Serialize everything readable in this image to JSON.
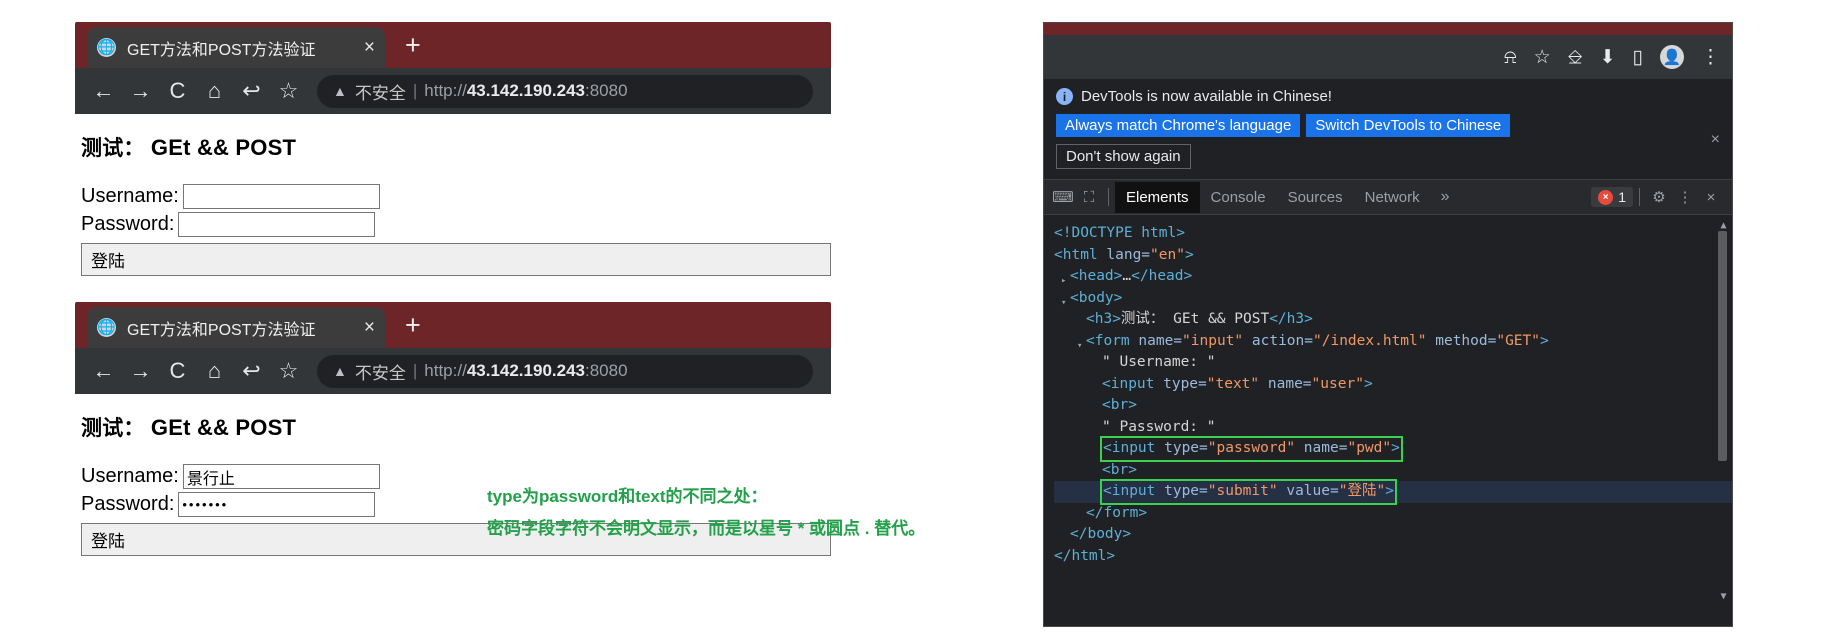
{
  "browser_windows": [
    {
      "tab": {
        "title": "GET方法和POST方法验证",
        "favicon": "globe-icon",
        "close": "×"
      },
      "new_tab": "+",
      "nav": {
        "back": "←",
        "forward": "→",
        "reload": "C",
        "home": "⌂",
        "undo": "↩",
        "bookmark": "☆"
      },
      "omnibox": {
        "warning": "▲",
        "insecure_label": "不安全",
        "separator": "|",
        "scheme": "http://",
        "host": "43.142.190.243",
        "port": ":8080"
      },
      "page": {
        "heading_cn": "测试：",
        "heading_en": "GEt && POST",
        "username_label": "Username:",
        "username_value": "",
        "password_label": "Password:",
        "password_value": "",
        "submit_label": "登陆"
      }
    },
    {
      "tab": {
        "title": "GET方法和POST方法验证",
        "favicon": "globe-icon",
        "close": "×"
      },
      "new_tab": "+",
      "nav": {
        "back": "←",
        "forward": "→",
        "reload": "C",
        "home": "⌂",
        "undo": "↩",
        "bookmark": "☆"
      },
      "omnibox": {
        "warning": "▲",
        "insecure_label": "不安全",
        "separator": "|",
        "scheme": "http://",
        "host": "43.142.190.243",
        "port": ":8080"
      },
      "page": {
        "heading_cn": "测试：",
        "heading_en": "GEt && POST",
        "username_label": "Username:",
        "username_value": "景行止",
        "password_label": "Password:",
        "password_value": "•••••••",
        "submit_label": "登陆"
      }
    }
  ],
  "annotation": {
    "line1": "type为password和text的不同之处：",
    "line2": "密码字段字符不会明文显示，而是以星号 * 或圆点 . 替代。",
    "color": "#22a04a"
  },
  "devtools": {
    "browser_toolbar": {
      "share_icon": "share-icon",
      "star_icon": "☆",
      "crop_icon": "crop-icon",
      "download_icon": "⬇",
      "sidepanel_icon": "sidepanel-icon",
      "avatar_icon": "●",
      "menu_icon": "⋮"
    },
    "notification": {
      "info_icon": "i",
      "message": "DevTools is now available in Chinese!",
      "primary_button": "Always match Chrome's language",
      "secondary_button": "Switch DevTools to Chinese",
      "tertiary_button": "Don't show again",
      "close": "×"
    },
    "tabbar": {
      "inspect_icon": "inspect-icon",
      "device_icon": "device-toggle-icon",
      "tabs": [
        "Elements",
        "Console",
        "Sources",
        "Network"
      ],
      "active_tab": "Elements",
      "overflow": "»",
      "error_count": "1",
      "error_icon": "×",
      "settings_icon": "⚙",
      "kebab_icon": "⋮",
      "close_icon": "×"
    },
    "dom_lines": [
      {
        "indent": 0,
        "triangle": "",
        "highlight": false,
        "selected": false,
        "parts": [
          {
            "t": "tag",
            "s": "<!DOCTYPE html>"
          }
        ]
      },
      {
        "indent": 0,
        "triangle": "",
        "highlight": false,
        "selected": false,
        "parts": [
          {
            "t": "tag",
            "s": "<html "
          },
          {
            "t": "attr",
            "s": "lang="
          },
          {
            "t": "val",
            "s": "\"en\""
          },
          {
            "t": "tag",
            "s": ">"
          }
        ]
      },
      {
        "indent": 1,
        "triangle": "▸",
        "highlight": false,
        "selected": false,
        "parts": [
          {
            "t": "tag",
            "s": "<head>"
          },
          {
            "t": "txt",
            "s": "…"
          },
          {
            "t": "tag",
            "s": "</head>"
          }
        ]
      },
      {
        "indent": 1,
        "triangle": "▾",
        "highlight": false,
        "selected": false,
        "parts": [
          {
            "t": "tag",
            "s": "<body>"
          }
        ]
      },
      {
        "indent": 2,
        "triangle": "",
        "highlight": false,
        "selected": false,
        "parts": [
          {
            "t": "tag",
            "s": "<h3>"
          },
          {
            "t": "txt",
            "s": "测试： GEt && POST"
          },
          {
            "t": "tag",
            "s": "</h3>"
          }
        ]
      },
      {
        "indent": 2,
        "triangle": "▾",
        "highlight": false,
        "selected": false,
        "parts": [
          {
            "t": "tag",
            "s": "<form "
          },
          {
            "t": "attr",
            "s": "name="
          },
          {
            "t": "val",
            "s": "\"input\""
          },
          {
            "t": "attr",
            "s": " action="
          },
          {
            "t": "val",
            "s": "\"/index.html\""
          },
          {
            "t": "attr",
            "s": " method="
          },
          {
            "t": "val",
            "s": "\"GET\""
          },
          {
            "t": "tag",
            "s": ">"
          }
        ]
      },
      {
        "indent": 3,
        "triangle": "",
        "highlight": false,
        "selected": false,
        "parts": [
          {
            "t": "txt",
            "s": "\" Username: \""
          }
        ]
      },
      {
        "indent": 3,
        "triangle": "",
        "highlight": false,
        "selected": false,
        "parts": [
          {
            "t": "tag",
            "s": "<input "
          },
          {
            "t": "attr",
            "s": "type="
          },
          {
            "t": "val",
            "s": "\"text\""
          },
          {
            "t": "attr",
            "s": " name="
          },
          {
            "t": "val",
            "s": "\"user\""
          },
          {
            "t": "tag",
            "s": ">"
          }
        ]
      },
      {
        "indent": 3,
        "triangle": "",
        "highlight": false,
        "selected": false,
        "parts": [
          {
            "t": "tag",
            "s": "<br>"
          }
        ]
      },
      {
        "indent": 3,
        "triangle": "",
        "highlight": false,
        "selected": false,
        "parts": [
          {
            "t": "txt",
            "s": "\" Password: \""
          }
        ]
      },
      {
        "indent": 3,
        "triangle": "",
        "highlight": true,
        "selected": false,
        "parts": [
          {
            "t": "tag",
            "s": "<input "
          },
          {
            "t": "attr",
            "s": "type="
          },
          {
            "t": "val",
            "s": "\"password\""
          },
          {
            "t": "attr",
            "s": " name="
          },
          {
            "t": "val",
            "s": "\"pwd\""
          },
          {
            "t": "tag",
            "s": ">"
          }
        ]
      },
      {
        "indent": 3,
        "triangle": "",
        "highlight": false,
        "selected": false,
        "parts": [
          {
            "t": "tag",
            "s": "<br>"
          }
        ]
      },
      {
        "indent": 3,
        "triangle": "",
        "highlight": true,
        "selected": true,
        "parts": [
          {
            "t": "tag",
            "s": "<input "
          },
          {
            "t": "attr",
            "s": "type="
          },
          {
            "t": "val",
            "s": "\"submit\""
          },
          {
            "t": "attr",
            "s": " value="
          },
          {
            "t": "val",
            "s": "\"登陆\""
          },
          {
            "t": "tag",
            "s": ">"
          }
        ]
      },
      {
        "indent": 2,
        "triangle": "",
        "highlight": false,
        "selected": false,
        "parts": [
          {
            "t": "tag",
            "s": "</form>"
          }
        ]
      },
      {
        "indent": 1,
        "triangle": "",
        "highlight": false,
        "selected": false,
        "parts": [
          {
            "t": "tag",
            "s": "</body>"
          }
        ]
      },
      {
        "indent": 0,
        "triangle": "",
        "highlight": false,
        "selected": false,
        "parts": [
          {
            "t": "tag",
            "s": "</html>"
          }
        ]
      }
    ],
    "scrollbar": {
      "up": "▲",
      "down": "▼"
    }
  }
}
